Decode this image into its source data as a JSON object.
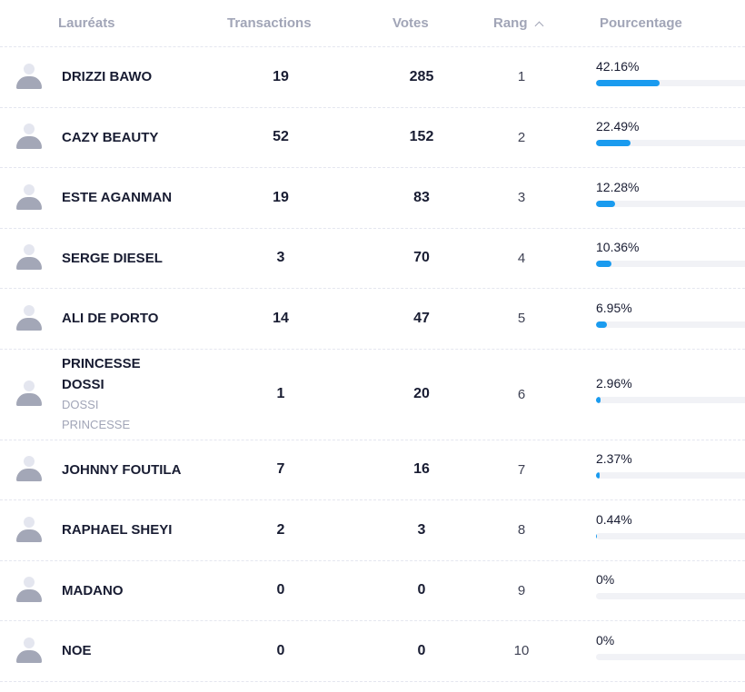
{
  "table": {
    "headers": {
      "laureats": "Lauréats",
      "transactions": "Transactions",
      "votes": "Votes",
      "rang": "Rang",
      "pourcentage": "Pourcentage"
    },
    "sort": {
      "column": "Rang",
      "direction": "ascending"
    },
    "accent_color": "#1a9bef",
    "rows": [
      {
        "name": "DRIZZI BAWO",
        "subtitle": "",
        "transactions": "19",
        "votes": "285",
        "rang": "1",
        "pourcentage": "42.16%",
        "percent_value": 42.16
      },
      {
        "name": "CAZY BEAUTY",
        "subtitle": "",
        "transactions": "52",
        "votes": "152",
        "rang": "2",
        "pourcentage": "22.49%",
        "percent_value": 22.49
      },
      {
        "name": "ESTE AGANMAN",
        "subtitle": "",
        "transactions": "19",
        "votes": "83",
        "rang": "3",
        "pourcentage": "12.28%",
        "percent_value": 12.28
      },
      {
        "name": "SERGE DIESEL",
        "subtitle": "",
        "transactions": "3",
        "votes": "70",
        "rang": "4",
        "pourcentage": "10.36%",
        "percent_value": 10.36
      },
      {
        "name": "ALI DE PORTO",
        "subtitle": "",
        "transactions": "14",
        "votes": "47",
        "rang": "5",
        "pourcentage": "6.95%",
        "percent_value": 6.95
      },
      {
        "name": "PRINCESSE DOSSI",
        "subtitle": "DOSSI PRINCESSE",
        "transactions": "1",
        "votes": "20",
        "rang": "6",
        "pourcentage": "2.96%",
        "percent_value": 2.96
      },
      {
        "name": "JOHNNY FOUTILA",
        "subtitle": "",
        "transactions": "7",
        "votes": "16",
        "rang": "7",
        "pourcentage": "2.37%",
        "percent_value": 2.37
      },
      {
        "name": "RAPHAEL SHEYI",
        "subtitle": "",
        "transactions": "2",
        "votes": "3",
        "rang": "8",
        "pourcentage": "0.44%",
        "percent_value": 0.44
      },
      {
        "name": "MADANO",
        "subtitle": "",
        "transactions": "0",
        "votes": "0",
        "rang": "9",
        "pourcentage": "0%",
        "percent_value": 0
      },
      {
        "name": "NOE",
        "subtitle": "",
        "transactions": "0",
        "votes": "0",
        "rang": "10",
        "pourcentage": "0%",
        "percent_value": 0
      }
    ]
  }
}
